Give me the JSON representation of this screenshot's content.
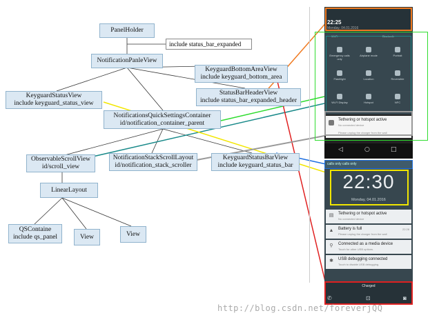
{
  "nodes": {
    "panel_holder": "PanelHolder",
    "include_status_bar_expanded": "include status_bar_expanded",
    "notification_panel_view": "NotificationPanleView",
    "keyguard_bottom_area_view": [
      "KeyguardBottomAreaView",
      "include keyguard_bottom_area"
    ],
    "keyguard_status_view": [
      "KeyguardStatusView",
      "include keyguard_status_view"
    ],
    "status_bar_header_view": [
      "StatusBarHeaderView",
      "include status_bar_expanded_header"
    ],
    "notifications_quick_settings_container": [
      "NotificationsQuickSettingsContainer",
      "id/notification_container_parent"
    ],
    "observable_scroll_view": [
      "ObservableScrollView",
      "id/scroll_view"
    ],
    "notification_stack_scroll_layout": [
      "NotificationStackScrollLayout",
      "id/notification_stack_scroller"
    ],
    "keyguard_status_bar_view": [
      "KeyguardStatusBarView",
      "include keyguard_status_bar"
    ],
    "linear_layout": "LinearLayout",
    "qs_container": [
      "QSContaine",
      "include qs_panel"
    ],
    "view_1": "View",
    "view_2": "View"
  },
  "phone_top": {
    "time": "22:25",
    "date": "Monday, 04.01.2016",
    "qs_header_left": "Wi-Fi",
    "qs_header_right": "Bluetooth",
    "tiles": [
      "Emergency calls only",
      "Airplane mode",
      "Portrait",
      "Flashlight",
      "Location",
      "Reversible",
      "Wi-Fi Display",
      "Hotspot",
      "NFC"
    ],
    "notification_title": "Tethering or hotspot active",
    "notification_sub": "No connected device",
    "notification_sub2": "Please unplug the charger from the wall",
    "nav": [
      "◁",
      "○",
      "□"
    ]
  },
  "phone_bottom": {
    "status": "calls only   calls only",
    "clock": "22:30",
    "date": "Monday, 04.01.2016",
    "cards": [
      {
        "title": "Tethering or hotspot active",
        "sub": "No connected device",
        "time": ""
      },
      {
        "title": "Battery is full",
        "sub": "Please unplug the charger from the wall",
        "time": "22:28"
      },
      {
        "title": "Connected as a media device",
        "sub": "Touch for other USB options.",
        "time": ""
      },
      {
        "title": "USB debugging connected",
        "sub": "Touch to disable USB debugging.",
        "time": ""
      }
    ],
    "charged": "Charged"
  },
  "watermark": "http://blog.csdn.net/foreverjQQ",
  "colors": {
    "node_fill": "#dbe8f3",
    "orange": "#f07a20",
    "green": "#2edc2e",
    "teal": "#1a8a8a",
    "yellow": "#f2e600",
    "red": "#e02020",
    "blue": "#1e6fe0",
    "gray": "#888888"
  }
}
